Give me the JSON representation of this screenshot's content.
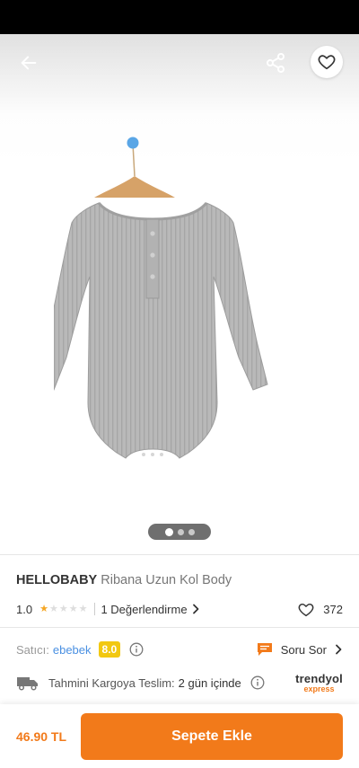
{
  "header": {
    "back_icon": "arrow-left-icon",
    "share_icon": "share-icon",
    "favorite_icon": "heart-outline-icon"
  },
  "gallery": {
    "image_description_icon": "baby-bodysuit-image",
    "pages": 3,
    "active_page": 1
  },
  "product": {
    "brand": "HELLOBABY",
    "name": "Ribana Uzun Kol Body"
  },
  "rating": {
    "score": "1.0",
    "stars_filled": 1,
    "stars_total": 5,
    "reviews_label": "1 Değerlendirme",
    "favorite_count": "372"
  },
  "seller": {
    "label": "Satıcı:",
    "name": "ebebek",
    "score": "8.0",
    "ask_label": "Soru Sor"
  },
  "shipping": {
    "label": "Tahmini Kargoya Teslim:",
    "value": "2 gün içinde",
    "logo_top": "trendyol",
    "logo_bottom": "express"
  },
  "footer": {
    "price": "46.90 TL",
    "add_to_cart": "Sepete Ekle"
  },
  "colors": {
    "accent": "#f27a1a",
    "link": "#4a90e2",
    "badge": "#f2c811"
  }
}
